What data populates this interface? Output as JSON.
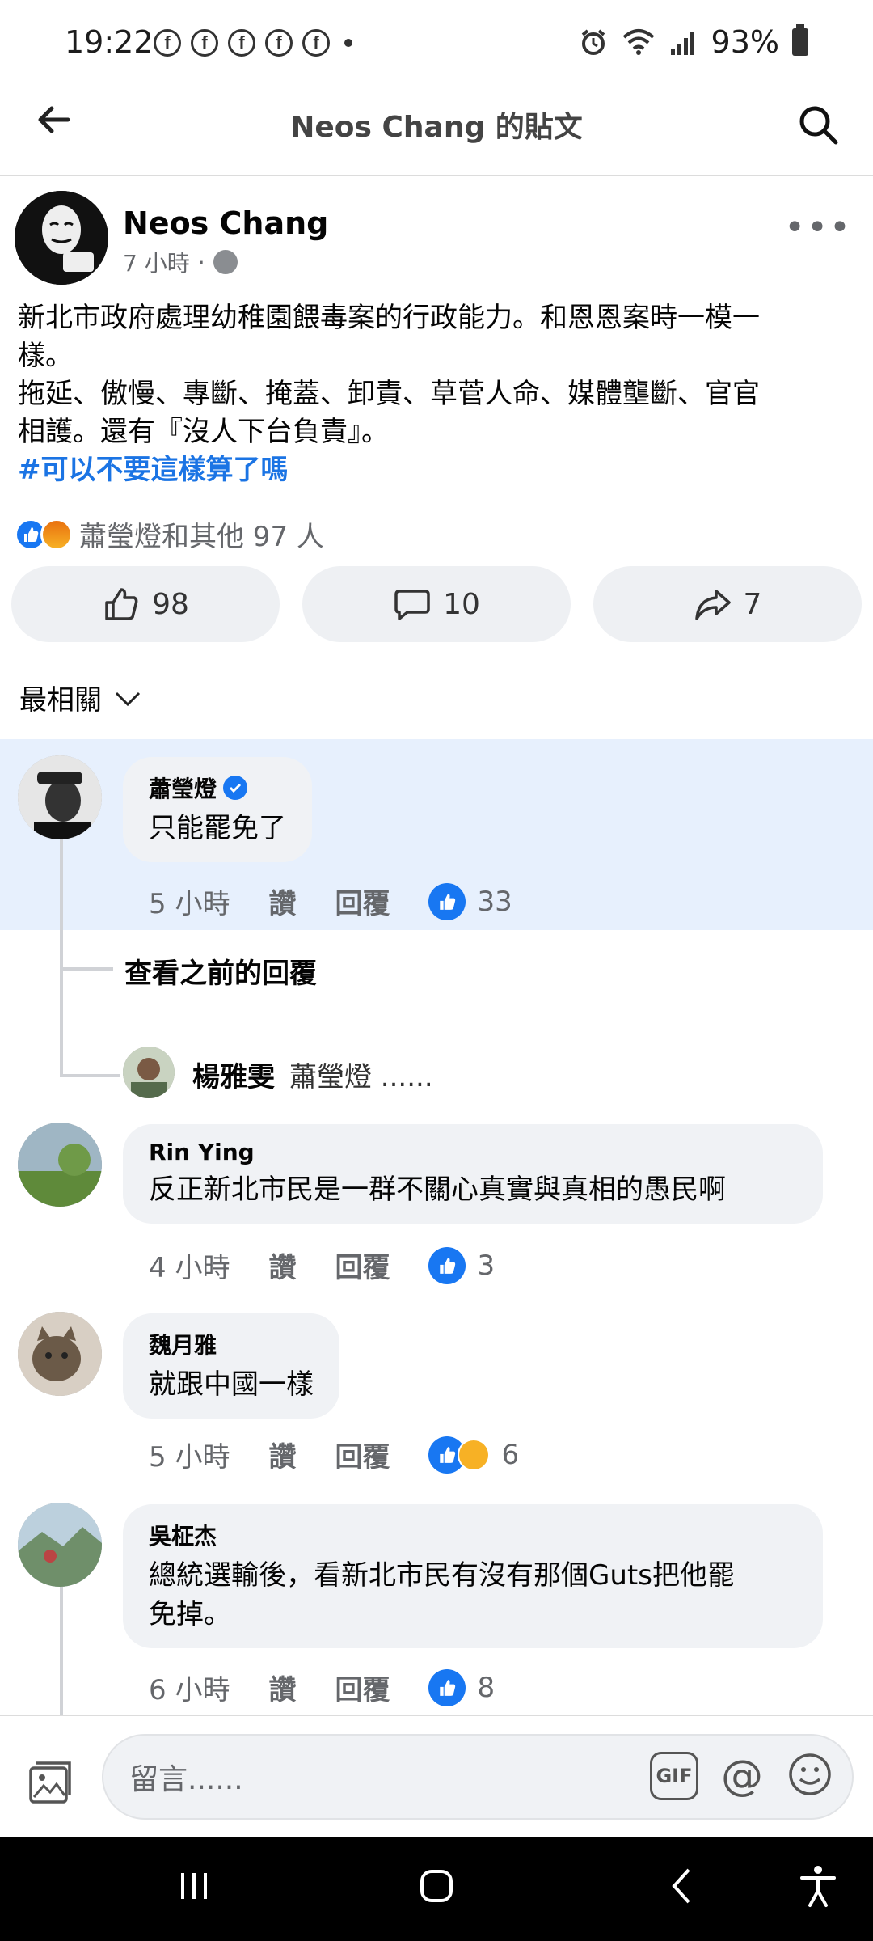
{
  "status_bar": {
    "time": "19:22",
    "notification_icons": [
      "f",
      "f",
      "f",
      "f",
      "f"
    ],
    "battery": "93%"
  },
  "header": {
    "title": "Neos Chang 的貼文"
  },
  "post": {
    "author": "Neos Chang",
    "time": "7 小時",
    "separator": "·",
    "body_lines": [
      "新北市政府處理幼稚園餵毒案的行政能力。和恩恩案時一模一",
      "樣。",
      "拖延、傲慢、專斷、掩蓋、卸責、草菅人命、媒體壟斷、官官",
      "相護。還有『沒人下台負責』。"
    ],
    "hashtag": "#可以不要這樣算了嗎",
    "reactions_summary": "蕭瑩燈和其他 97 人",
    "like_count": "98",
    "comment_count": "10",
    "share_count": "7"
  },
  "sort": {
    "label": "最相關"
  },
  "comments": [
    {
      "name": "蕭瑩燈",
      "text": "只能罷免了",
      "time": "5 小時",
      "like_label": "讚",
      "reply_label": "回覆",
      "reactions": "33"
    },
    {
      "name": "Rin Ying",
      "text": "反正新北市民是一群不關心真實與真相的愚民啊",
      "time": "4 小時",
      "like_label": "讚",
      "reply_label": "回覆",
      "reactions": "3"
    },
    {
      "name": "魏月雅",
      "text": "就跟中國一樣",
      "time": "5 小時",
      "like_label": "讚",
      "reply_label": "回覆",
      "reactions": "6"
    },
    {
      "name": "吳柾杰",
      "text_lines": [
        "總統選輸後，看新北市民有沒有那個Guts把他罷",
        "免掉。"
      ],
      "time": "6 小時",
      "like_label": "讚",
      "reply_label": "回覆",
      "reactions": "8"
    }
  ],
  "replies": {
    "view_previous": "查看之前的回覆",
    "reply_author": "楊雅雯",
    "reply_preview": "蕭瑩燈 ......"
  },
  "composer": {
    "placeholder": "留言......",
    "gif_label": "GIF",
    "at_label": "@"
  },
  "colors": {
    "accent": "#1877f2",
    "highlight": "#e7f0fd",
    "bubble": "#f0f2f5"
  }
}
